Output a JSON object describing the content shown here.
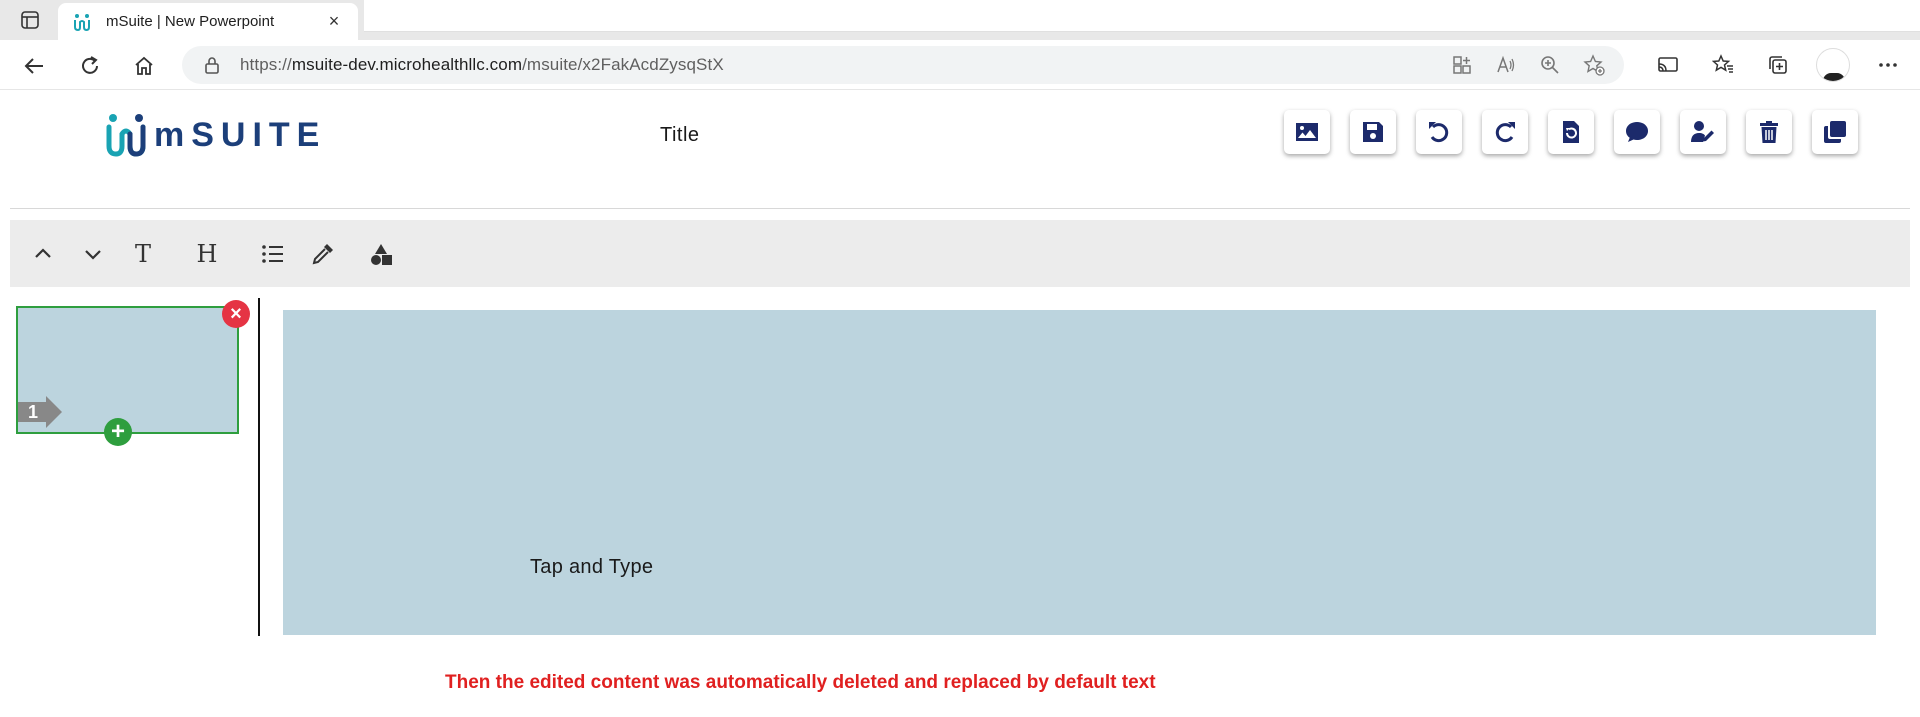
{
  "browser": {
    "tab_title": "mSuite | New Powerpoint",
    "tab_close": "×",
    "url_prefix": "https://",
    "url_host": "msuite-dev.microhealthllc.com",
    "url_path": "/msuite/x2FakAcdZysqStX"
  },
  "app": {
    "logo_text": "mSUITE",
    "doc_title": "Title",
    "brand_color": "#1c3f7a",
    "accent_teal": "#19a3b3",
    "actions": [
      {
        "name": "insert-image-button",
        "icon": "image-icon"
      },
      {
        "name": "save-button",
        "icon": "save-icon"
      },
      {
        "name": "undo-button",
        "icon": "undo-icon"
      },
      {
        "name": "redo-button",
        "icon": "redo-icon"
      },
      {
        "name": "history-button",
        "icon": "file-history-icon"
      },
      {
        "name": "comments-button",
        "icon": "comment-icon"
      },
      {
        "name": "edit-user-button",
        "icon": "user-edit-icon"
      },
      {
        "name": "delete-button",
        "icon": "trash-icon"
      },
      {
        "name": "duplicate-button",
        "icon": "copy-icon"
      }
    ]
  },
  "toolbar": {
    "items": [
      "move-up",
      "move-down",
      "text",
      "heading",
      "list",
      "color-picker",
      "shapes"
    ],
    "text_glyph": "T",
    "heading_glyph": "H"
  },
  "slides": {
    "thumbnails": [
      {
        "number": "1",
        "selected": true
      }
    ],
    "delete_glyph": "×",
    "add_glyph": "+"
  },
  "canvas": {
    "background": "#bcd4de",
    "text": "Tap and Type"
  },
  "annotation": {
    "text": "Then the edited content was automatically deleted and replaced by default text",
    "color": "#e02020"
  }
}
